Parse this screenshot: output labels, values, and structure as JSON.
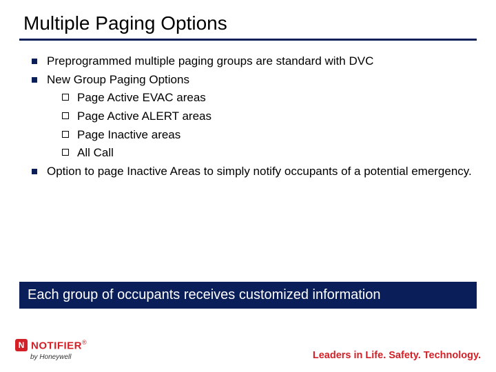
{
  "title": "Multiple Paging Options",
  "bullets": {
    "b1": "Preprogrammed multiple paging groups are standard with DVC",
    "b2": "New Group Paging Options",
    "b2_sub": {
      "s1": "Page Active EVAC areas",
      "s2": "Page Active ALERT areas",
      "s3": "Page Inactive areas",
      "s4": "All Call"
    },
    "b3": "Option to page Inactive Areas to simply notify occupants of a potential emergency."
  },
  "banner": "Each group of occupants receives customized information",
  "logo": {
    "mark": "N",
    "name": "NOTIFIER",
    "reg": "®",
    "byline": "by Honeywell"
  },
  "tagline": "Leaders in Life. Safety. Technology."
}
